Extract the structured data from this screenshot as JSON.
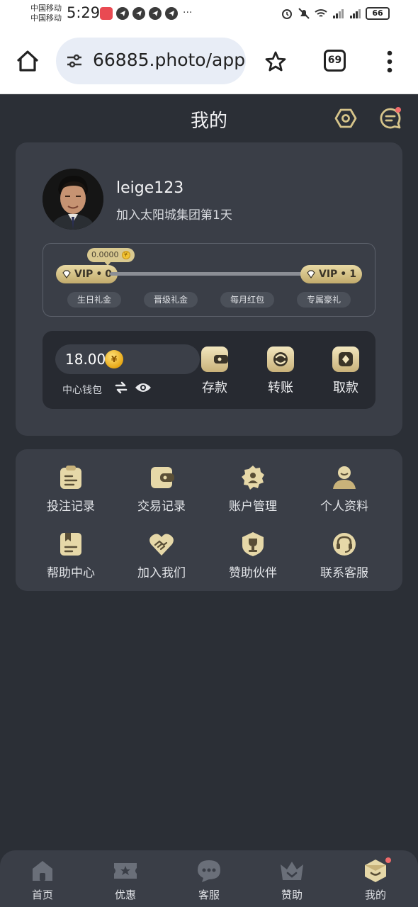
{
  "status_bar": {
    "carrier_1": "中国移动",
    "carrier_2": "中国移动",
    "time": "5:29",
    "more": "···",
    "battery": "66"
  },
  "browser": {
    "url": "66885.photo/app",
    "tab_count": "69"
  },
  "header": {
    "title": "我的"
  },
  "profile": {
    "username": "leige123",
    "join_text": "加入太阳城集团第1天"
  },
  "vip": {
    "current_label": "VIP",
    "current_level": "0",
    "next_label": "VIP",
    "next_level": "1",
    "progress_amount": "0.0000",
    "progress": 0.0,
    "gifts": [
      "生日礼金",
      "晋级礼金",
      "每月红包",
      "专属豪礼"
    ]
  },
  "wallet": {
    "balance": "18.00",
    "coin_symbol": "¥",
    "label": "中心钱包",
    "actions": {
      "deposit": "存款",
      "transfer": "转账",
      "withdraw": "取款"
    }
  },
  "menu": {
    "items": [
      {
        "label": "投注记录",
        "icon": "bet-record-icon"
      },
      {
        "label": "交易记录",
        "icon": "wallet-record-icon"
      },
      {
        "label": "账户管理",
        "icon": "account-gear-icon"
      },
      {
        "label": "个人资料",
        "icon": "profile-icon"
      },
      {
        "label": "帮助中心",
        "icon": "help-book-icon"
      },
      {
        "label": "加入我们",
        "icon": "handshake-heart-icon"
      },
      {
        "label": "赞助伙伴",
        "icon": "trophy-shield-icon"
      },
      {
        "label": "联系客服",
        "icon": "headset-icon"
      }
    ]
  },
  "bottom_nav": {
    "items": [
      {
        "label": "首页",
        "icon": "home-icon"
      },
      {
        "label": "优惠",
        "icon": "ticket-icon"
      },
      {
        "label": "客服",
        "icon": "chat-icon"
      },
      {
        "label": "赞助",
        "icon": "crown-icon"
      },
      {
        "label": "我的",
        "icon": "profile-box-icon"
      }
    ],
    "active_index": 4
  },
  "colors": {
    "background": "#2b2f36",
    "card": "#3a3e47",
    "gold": "#d6c48a",
    "notification_dot": "#ef6a6a"
  }
}
